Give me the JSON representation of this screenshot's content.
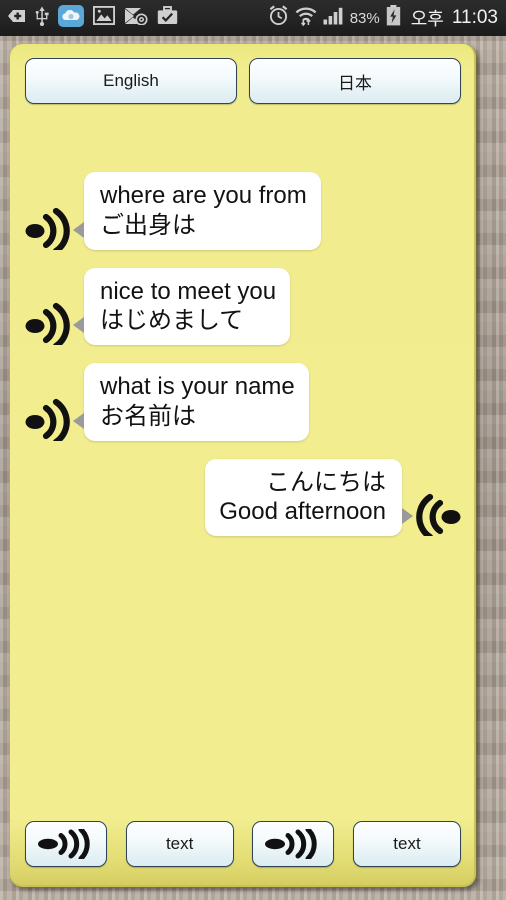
{
  "status_bar": {
    "icons_left": [
      "tag-plus-icon",
      "usb-icon",
      "cloud-sync-icon",
      "photo-icon",
      "mail-at-icon",
      "briefcase-check-icon"
    ],
    "icons_right": [
      "alarm-clock-icon",
      "wifi-transfer-icon",
      "signal-bars-icon"
    ],
    "battery_percent": "83%",
    "battery_icon": "battery-charging-icon",
    "am_pm": "오후",
    "clock": "11:03"
  },
  "language_bar": {
    "left_label": "English",
    "right_label": "日本"
  },
  "conversation": {
    "messages": [
      {
        "align": "left",
        "speaker_icon": "speaker-wave-icon",
        "line1": "where are you from",
        "line2": "ご出身は"
      },
      {
        "align": "left",
        "speaker_icon": "speaker-wave-icon",
        "line1": "nice to meet you",
        "line2": "はじめまして"
      },
      {
        "align": "left",
        "speaker_icon": "speaker-wave-icon",
        "line1": "what is your name",
        "line2": "お名前は"
      },
      {
        "align": "right",
        "speaker_icon": "speaker-wave-icon-flipped",
        "line1": "こんにちは",
        "line2": "Good afternoon"
      }
    ]
  },
  "bottom_bar": {
    "buttons": [
      {
        "type": "icon",
        "icon": "speak-arrow-icon",
        "label": ""
      },
      {
        "type": "text",
        "icon": "",
        "label": "text"
      },
      {
        "type": "icon",
        "icon": "speak-arrow-icon",
        "label": ""
      },
      {
        "type": "text",
        "icon": "",
        "label": "text"
      }
    ]
  },
  "colors": {
    "panel_yellow": "#f1ed8e",
    "panel_edge": "#c9c257",
    "bubble_white": "#ffffff",
    "bubble_tail_gray": "#9a9a9a",
    "button_border": "#2f4458",
    "status_bar_bg": "#242424",
    "backdrop": "#a79b90"
  }
}
